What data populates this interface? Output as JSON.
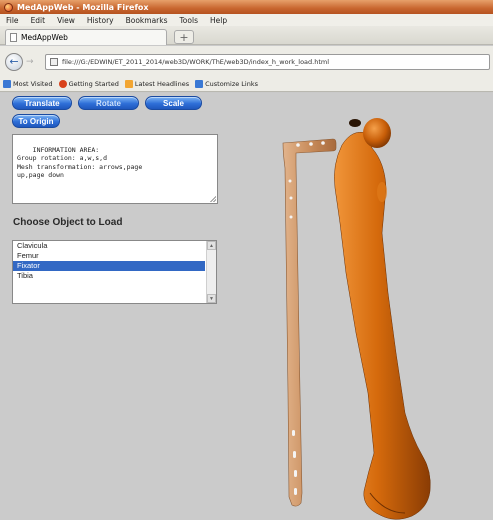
{
  "window": {
    "title": "MedAppWeb - Mozilla Firefox"
  },
  "menu": [
    "File",
    "Edit",
    "View",
    "History",
    "Bookmarks",
    "Tools",
    "Help"
  ],
  "tab": {
    "label": "MedAppWeb",
    "new_tab": "+"
  },
  "nav": {
    "back": "←",
    "forward": "→",
    "url": "file:///G:/EDWIN/ET_2011_2014/web3D/WORK/ThE/web3D/index_h_work_load.html"
  },
  "bookmarks": [
    {
      "label": "Most Visited",
      "color": "#3a78d4"
    },
    {
      "label": "Getting Started",
      "color": "#d9421b"
    },
    {
      "label": "Latest Headlines",
      "color": "#f2a531"
    },
    {
      "label": "Customize Links",
      "color": "#3a78d4"
    }
  ],
  "toolbar": {
    "translate": "Translate",
    "rotate": "Rotate",
    "scale": "Scale",
    "to_origin": "To Origin"
  },
  "info_area": {
    "text": "INFORMATION AREA:\nGroup rotation: a,w,s,d\nMesh transformation: arrows,page\nup,page down"
  },
  "object_loader": {
    "title": "Choose Object to Load",
    "options": [
      "Clavicula",
      "Femur",
      "Fixator",
      "Tibia"
    ],
    "selected": "Fixator"
  },
  "scene": {
    "background": "#cbcbcb",
    "fixator_color": "#d39a68",
    "femur_color": "#d56a0c"
  }
}
